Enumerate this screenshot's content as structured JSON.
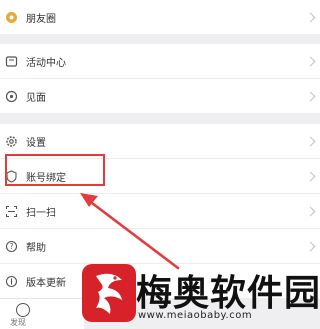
{
  "menu": {
    "moments": "朋友圈",
    "activity_center": "活动中心",
    "meet": "见面",
    "settings": "设置",
    "account_binding": "账号绑定",
    "scan": "扫一扫",
    "help": "帮助",
    "version_update": "版本更新"
  },
  "bottom_tab": {
    "label": "发现"
  },
  "watermark": {
    "title": "梅奥软件园",
    "url": "www.meiaobaby.com"
  },
  "colors": {
    "highlight": "#e23d3d",
    "arrow": "#e23d3d",
    "brand_red": "#d8222a",
    "moments_icon": "#e8a83a"
  }
}
